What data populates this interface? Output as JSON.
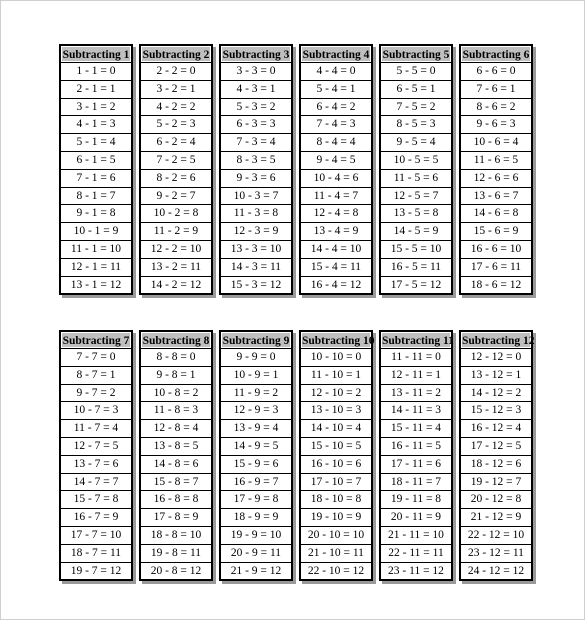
{
  "blocks": [
    {
      "tables": [
        {
          "title": "Subtracting 1",
          "rows": [
            "1 - 1 = 0",
            "2 - 1 = 1",
            "3 - 1 = 2",
            "4 - 1 = 3",
            "5 - 1 = 4",
            "6 - 1 = 5",
            "7 - 1 = 6",
            "8 - 1 = 7",
            "9 - 1 = 8",
            "10 - 1 = 9",
            "11 - 1 = 10",
            "12 - 1 = 11",
            "13 - 1 = 12"
          ]
        },
        {
          "title": "Subtracting 2",
          "rows": [
            "2 - 2 = 0",
            "3 - 2 = 1",
            "4 - 2 = 2",
            "5 - 2 = 3",
            "6 - 2 = 4",
            "7 - 2 = 5",
            "8 - 2 = 6",
            "9 - 2 = 7",
            "10 - 2 = 8",
            "11 - 2 = 9",
            "12 - 2 = 10",
            "13 - 2 = 11",
            "14 - 2 = 12"
          ]
        },
        {
          "title": "Subtracting 3",
          "rows": [
            "3 - 3 = 0",
            "4 - 3 = 1",
            "5 - 3 = 2",
            "6 - 3 = 3",
            "7 - 3 = 4",
            "8 - 3 = 5",
            "9 - 3 = 6",
            "10 - 3 = 7",
            "11 - 3 = 8",
            "12 - 3 = 9",
            "13 - 3 = 10",
            "14 - 3 = 11",
            "15 - 3 = 12"
          ]
        },
        {
          "title": "Subtracting 4",
          "rows": [
            "4 - 4 = 0",
            "5 - 4 = 1",
            "6 - 4 = 2",
            "7 - 4 = 3",
            "8 - 4 = 4",
            "9 - 4 = 5",
            "10 - 4 = 6",
            "11 - 4 = 7",
            "12 - 4 = 8",
            "13 - 4 = 9",
            "14 - 4 = 10",
            "15 - 4 = 11",
            "16 - 4 = 12"
          ]
        },
        {
          "title": "Subtracting 5",
          "rows": [
            "5 - 5 = 0",
            "6 - 5 = 1",
            "7 - 5 = 2",
            "8 - 5 = 3",
            "9 - 5 = 4",
            "10 - 5 = 5",
            "11 - 5 = 6",
            "12 - 5 = 7",
            "13 - 5 = 8",
            "14 - 5 = 9",
            "15 - 5 = 10",
            "16 - 5 = 11",
            "17 - 5 = 12"
          ]
        },
        {
          "title": "Subtracting 6",
          "rows": [
            "6 - 6 = 0",
            "7 - 6 = 1",
            "8 - 6 = 2",
            "9 - 6 = 3",
            "10 - 6 = 4",
            "11 - 6 = 5",
            "12 - 6 = 6",
            "13 - 6 = 7",
            "14 - 6 = 8",
            "15 - 6 = 9",
            "16 - 6 = 10",
            "17 - 6 = 11",
            "18 - 6 = 12"
          ]
        }
      ]
    },
    {
      "tables": [
        {
          "title": "Subtracting 7",
          "rows": [
            "7 - 7 = 0",
            "8 - 7 = 1",
            "9 - 7 = 2",
            "10 - 7 = 3",
            "11 - 7 = 4",
            "12 - 7 = 5",
            "13 - 7 = 6",
            "14 - 7 = 7",
            "15 - 7 = 8",
            "16 - 7 = 9",
            "17 - 7 = 10",
            "18 - 7 = 11",
            "19 - 7 = 12"
          ]
        },
        {
          "title": "Subtracting 8",
          "rows": [
            "8 - 8 = 0",
            "9 - 8 = 1",
            "10 - 8 = 2",
            "11 - 8 = 3",
            "12 - 8 = 4",
            "13 - 8 = 5",
            "14 - 8 = 6",
            "15 - 8 = 7",
            "16 - 8 = 8",
            "17 - 8 = 9",
            "18 - 8 = 10",
            "19 - 8 = 11",
            "20 - 8 = 12"
          ]
        },
        {
          "title": "Subtracting 9",
          "rows": [
            "9 - 9 = 0",
            "10 - 9 = 1",
            "11 - 9 = 2",
            "12 - 9 = 3",
            "13 - 9 = 4",
            "14 - 9 = 5",
            "15 - 9 = 6",
            "16 - 9 = 7",
            "17 - 9 = 8",
            "18 - 9 = 9",
            "19 - 9 = 10",
            "20 - 9 = 11",
            "21 - 9 = 12"
          ]
        },
        {
          "title": "Subtracting 10",
          "rows": [
            "10 - 10 = 0",
            "11 - 10 = 1",
            "12 - 10 = 2",
            "13 - 10 = 3",
            "14 - 10 = 4",
            "15 - 10 = 5",
            "16 - 10 = 6",
            "17 - 10 = 7",
            "18 - 10 = 8",
            "19 - 10 = 9",
            "20 - 10 = 10",
            "21 - 10 = 11",
            "22 - 10 = 12"
          ]
        },
        {
          "title": "Subtracting 11",
          "rows": [
            "11 - 11 = 0",
            "12 - 11 = 1",
            "13 - 11 = 2",
            "14 - 11 = 3",
            "15 - 11 = 4",
            "16 - 11 = 5",
            "17 - 11 = 6",
            "18 - 11 = 7",
            "19 - 11 = 8",
            "20 - 11 = 9",
            "21 - 11 = 10",
            "22 - 11 = 11",
            "23 - 11 = 12"
          ]
        },
        {
          "title": "Subtracting 12",
          "rows": [
            "12 - 12 = 0",
            "13 - 12 = 1",
            "14 - 12 = 2",
            "15 - 12 = 3",
            "16 - 12 = 4",
            "17 - 12 = 5",
            "18 - 12 = 6",
            "19 - 12 = 7",
            "20 - 12 = 8",
            "21 - 12 = 9",
            "22 - 12 = 10",
            "23 - 12 = 11",
            "24 - 12 = 12"
          ]
        }
      ]
    }
  ]
}
